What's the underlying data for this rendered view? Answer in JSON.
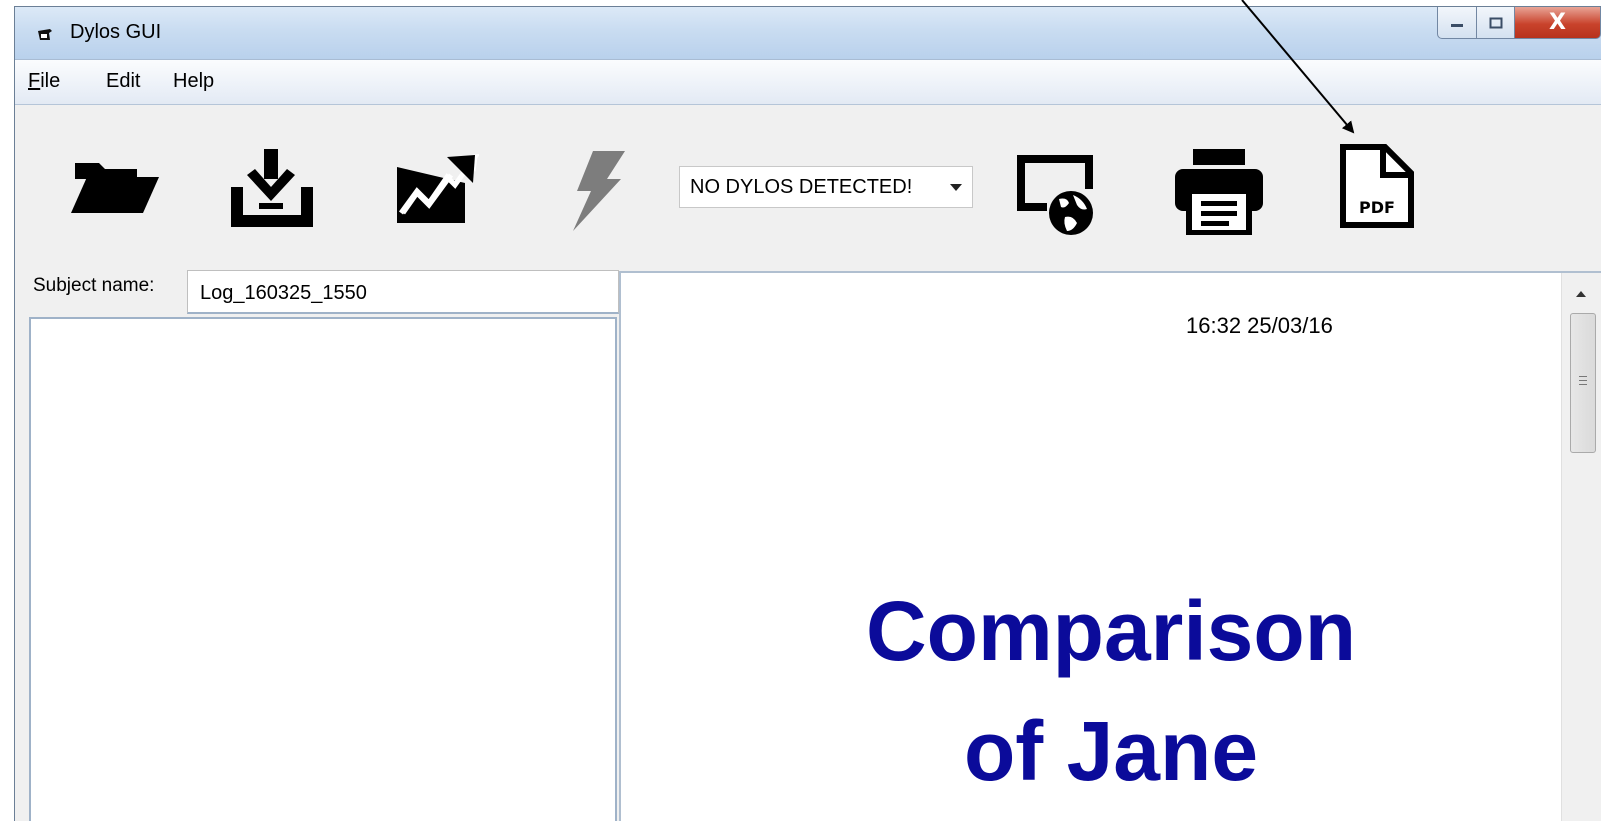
{
  "window": {
    "title": "Dylos GUI",
    "close_glyph": "X",
    "accent_titlebar": "#c9dcf1"
  },
  "menu": {
    "items": [
      {
        "label": "File"
      },
      {
        "label": "Edit"
      },
      {
        "label": "Help"
      }
    ]
  },
  "toolbar": {
    "buttons": [
      {
        "name": "open-folder-icon"
      },
      {
        "name": "download-icon"
      },
      {
        "name": "chart-trend-icon"
      },
      {
        "name": "lightning-icon",
        "state": "disabled"
      },
      {
        "name": "web-globe-icon"
      },
      {
        "name": "printer-icon"
      },
      {
        "name": "pdf-icon",
        "label": "PDF"
      }
    ],
    "device_select": {
      "value": "NO DYLOS DETECTED!"
    }
  },
  "subject": {
    "label": "Subject name:",
    "value": "Log_160325_1550"
  },
  "preview": {
    "timestamp": "16:32 25/03/16",
    "title_line1": "Comparison",
    "title_line2": "of Jane",
    "title_color": "#0b0b9a"
  }
}
